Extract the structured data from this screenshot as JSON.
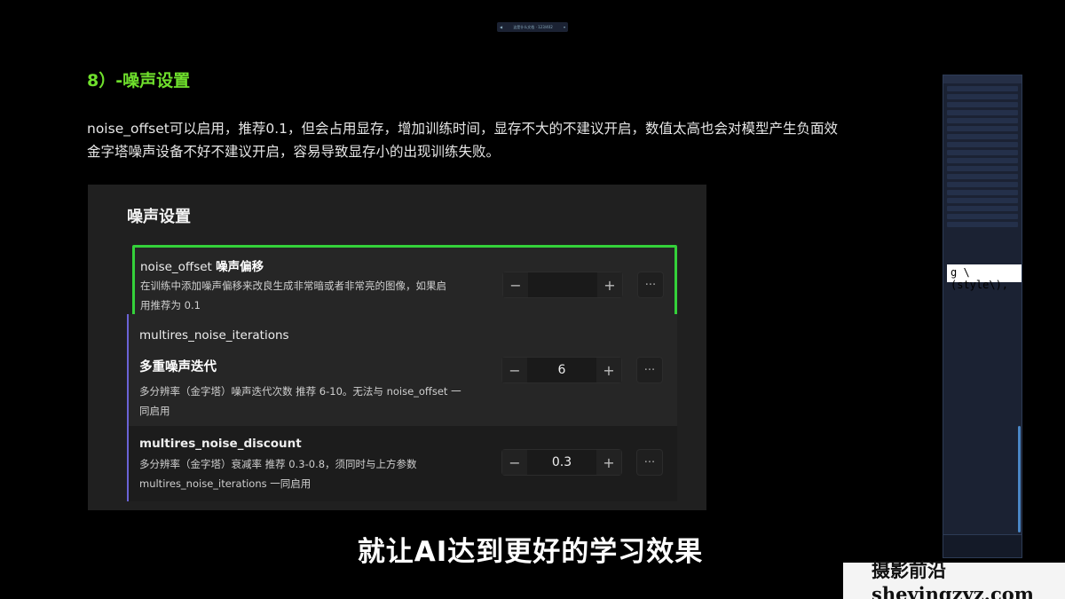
{
  "top_bar": {
    "left_icon": "chevron-left-icon",
    "text": "这是什么文档 · 123/402",
    "right_icon": "chevron-down-icon"
  },
  "section": {
    "title": "8）-噪声设置",
    "paragraph_line1": "noise_offset可以启用，推荐0.1，但会占用显存，增加训练时间，显存不大的不建议开启，数值太高也会对模型产生负面效",
    "paragraph_line2": "金字塔噪声设备不好不建议开启，容易导致显存小的出现训练失败。"
  },
  "panel": {
    "title": "噪声设置",
    "settings": [
      {
        "name": "noise_offset",
        "name_cn": "噪声偏移",
        "desc_line1": "在训练中添加噪声偏移来改良生成非常暗或者非常亮的图像，如果启",
        "desc_line2": "用推荐为 0.1",
        "value": "",
        "minus": "−",
        "plus": "+",
        "more": "···"
      },
      {
        "name": "multires_noise_iterations",
        "name_cn": "多重噪声迭代",
        "desc_line1": "多分辨率（金字塔）噪声迭代次数 推荐 6-10。无法与 noise_offset 一",
        "desc_line2": "同启用",
        "value": "6",
        "minus": "−",
        "plus": "+",
        "more": "···"
      },
      {
        "name": "multires_noise_discount",
        "desc_line1": "多分辨率（金字塔）衰减率 推荐 0.3-0.8，须同时与上方参数",
        "desc_line2": "multires_noise_iterations 一同启用",
        "value": "0.3",
        "minus": "−",
        "plus": "+",
        "more": "···"
      }
    ]
  },
  "caption": "就让AI达到更好的学习效果",
  "watermark": "摄影前沿 sheyingzyz.com",
  "side_panel": {
    "code_snippet": "g \\(style\\),"
  },
  "colors": {
    "accent_green": "#6fe02c",
    "highlight_border": "#34d13a",
    "purple_bar": "#6a63d6"
  }
}
